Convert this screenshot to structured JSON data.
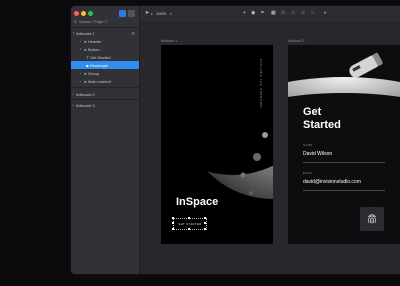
{
  "sidebar": {
    "search_label": "Search \"Page 1\"",
    "layers": [
      {
        "label": "Artboard 1",
        "glyph": "",
        "caret": "▾"
      },
      {
        "label": "Header",
        "glyph": "■",
        "caret": "▸"
      },
      {
        "label": "Button",
        "glyph": "■",
        "caret": "▾"
      },
      {
        "label": "Get Started",
        "glyph": "T",
        "caret": ""
      },
      {
        "label": "Rectangle",
        "glyph": "■",
        "caret": ""
      },
      {
        "label": "Group",
        "glyph": "■",
        "caret": "▸"
      },
      {
        "label": "Main content",
        "glyph": "■",
        "caret": "▸"
      },
      {
        "label": "Artboard 2",
        "glyph": "",
        "caret": "▸"
      },
      {
        "label": "Artboard 3",
        "glyph": "",
        "caret": "▸"
      }
    ]
  },
  "toolbar": {
    "zoom": "100%"
  },
  "artboards": {
    "ab1": {
      "label": "Artboard 1",
      "vertical_text": "EXPLORE THE UNKNOWN",
      "title": "InSpace",
      "button": "GET STARTED"
    },
    "ab2": {
      "label": "Artboard 2",
      "title": "Get\nStarted",
      "name_label": "NAME",
      "name_value": "David Wilson",
      "email_label": "EMAIL",
      "email_value": "david@invisionstudio.com"
    }
  },
  "colors": {
    "accent": "#2f8cf0",
    "canvas": "#28282c",
    "sidebar": "#313136"
  },
  "icons": [
    "search-icon",
    "move-tool-icon",
    "add-icon",
    "grid-icon",
    "frame-icon",
    "fingerprint-icon",
    "gear-icon"
  ]
}
